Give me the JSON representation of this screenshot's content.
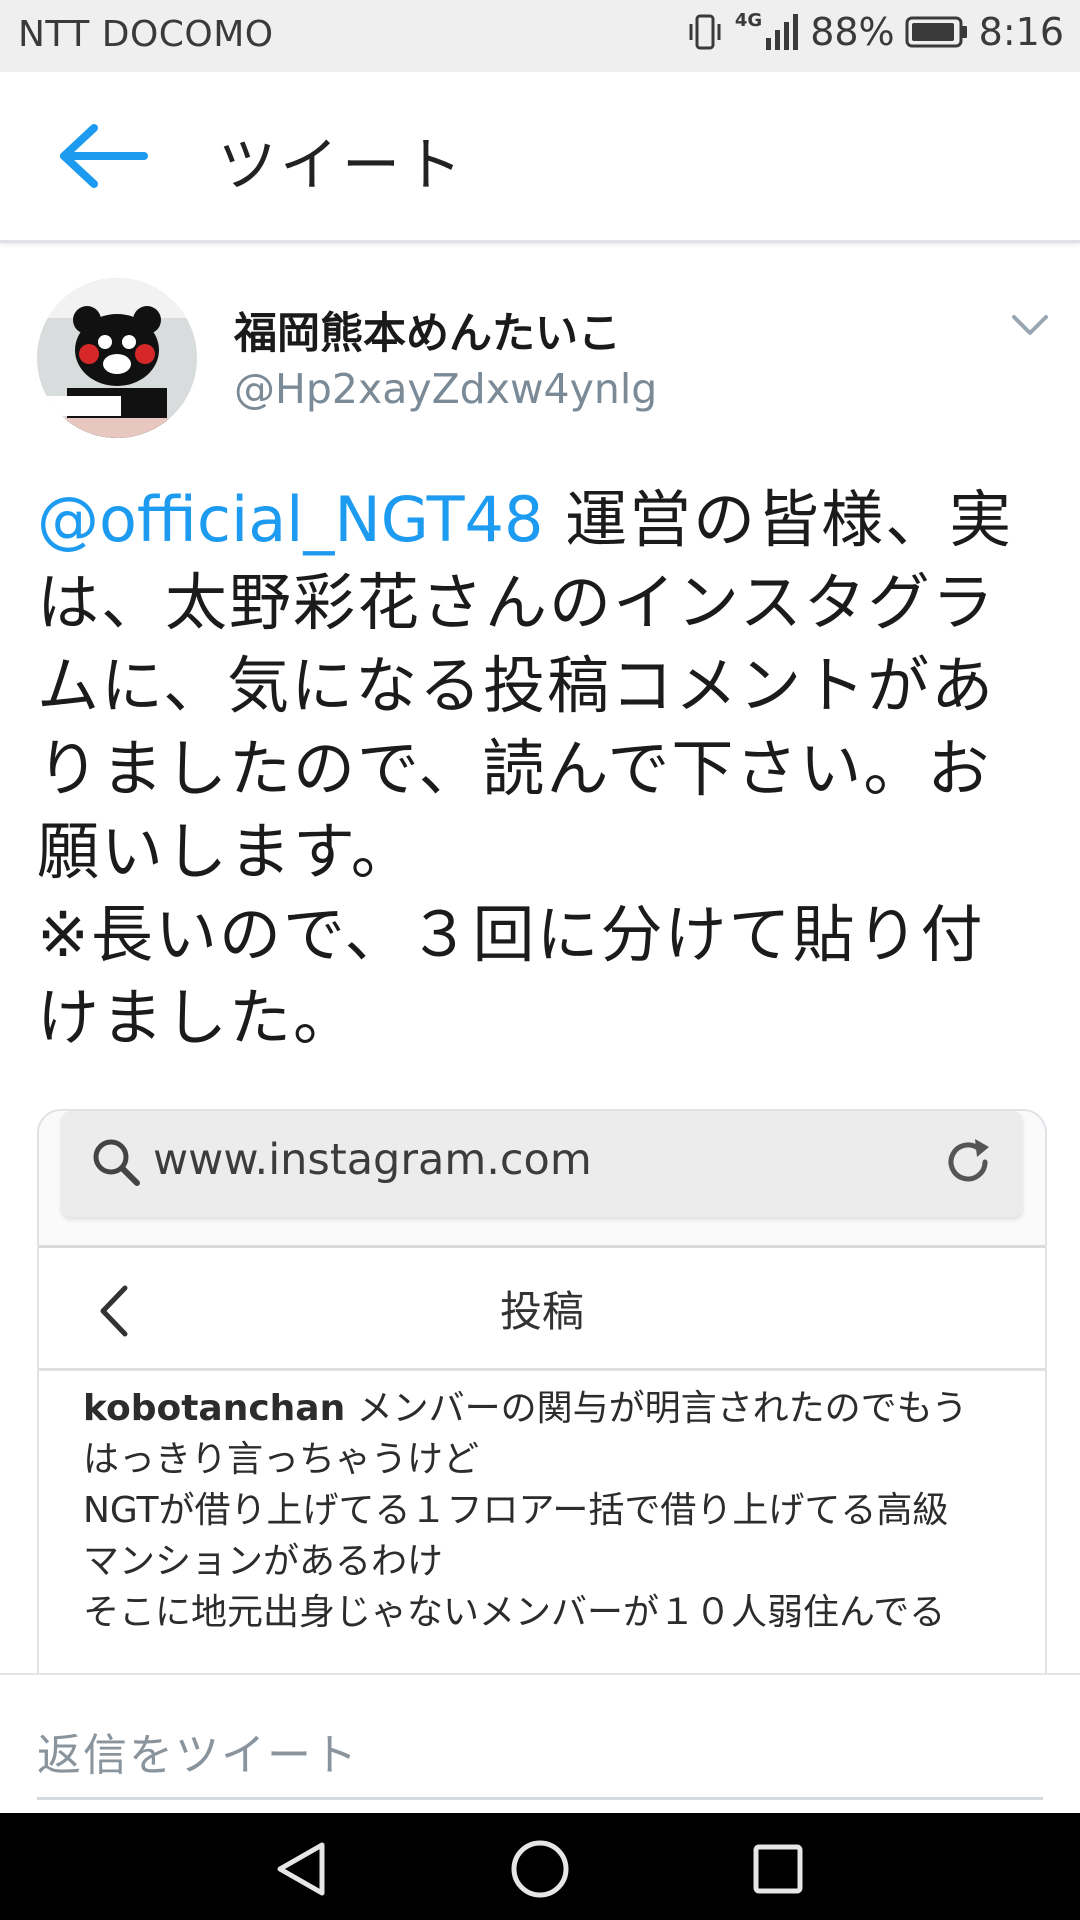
{
  "status_bar": {
    "carrier": "NTT DOCOMO",
    "network": "4G",
    "battery": "88%",
    "time": "8:16",
    "icons": [
      "vibrate-icon",
      "signal-icon",
      "battery-icon"
    ]
  },
  "app_bar": {
    "title": "ツイート",
    "back_icon": "arrow-left-icon"
  },
  "tweet": {
    "display_name": "福岡熊本めんたいこ",
    "handle": "@Hp2xayZdxw4ynlg",
    "mention": "@official_NGT48",
    "body": " 運営の皆様、実は、太野彩花さんのインスタグラムに、気になる投稿コメントがありましたので、読んで下さい。お願いします。\n※長いので、３回に分けて貼り付けました。",
    "avatar_icon": "kumamon-avatar",
    "menu_icon": "chevron-down-icon"
  },
  "media": {
    "url": "www.instagram.com",
    "page_title": "投稿",
    "caption_user": "kobotanchan",
    "caption_text": " メンバーの関与が明言されたのでもうはっきり言っちゃうけど\nNGTが借り上げてる１フロアー括で借り上げてる高級マンションがあるわけ\nそこに地元出身じゃないメンバーが１０人弱住んでる"
  },
  "reply": {
    "placeholder": "返信をツイート"
  },
  "colors": {
    "accent": "#1d9bf0",
    "status_bar_bg": "#efefef",
    "nav_bar_bg": "#000000"
  }
}
